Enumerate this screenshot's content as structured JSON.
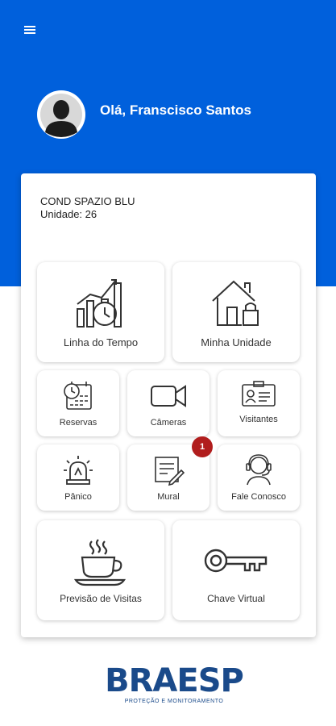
{
  "header": {
    "greeting": "Olá, Franscisco Santos",
    "accent_color": "#0060dc",
    "menu_icon": "hamburger-menu-icon"
  },
  "condo": {
    "name": "COND SPAZIO BLU",
    "unit": "Unidade: 26"
  },
  "tiles": {
    "linha_do_tempo": "Linha do Tempo",
    "minha_unidade": "Minha Unidade",
    "reservas": "Reservas",
    "cameras": "Câmeras",
    "visitantes": "Visitantes",
    "panico": "Pânico",
    "mural": "Mural",
    "mural_badge": "1",
    "fale_conosco": "Fale Conosco",
    "previsao_visitas": "Previsão de Visitas",
    "chave_virtual": "Chave Virtual"
  },
  "brand": {
    "logo": "BRAESP",
    "tagline": "PROTEÇÃO E MONITORAMENTO",
    "color": "#1a4a8a"
  }
}
